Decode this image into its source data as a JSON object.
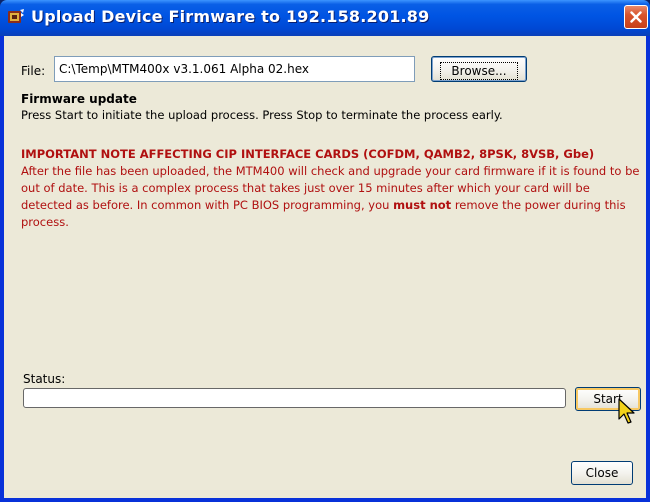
{
  "window": {
    "title": "Upload Device Firmware to 192.158.201.89",
    "icon": "app-icon",
    "close_icon": "close-icon"
  },
  "file": {
    "label": "File:",
    "value": "C:\\Temp\\MTM400x v3.1.061 Alpha 02.hex",
    "browse_label": "Browse..."
  },
  "firmware": {
    "title": "Firmware update",
    "description": "Press Start to initiate the upload process. Press Stop to terminate the process early."
  },
  "important": {
    "title": "IMPORTANT NOTE AFFECTING CIP INTERFACE CARDS (COFDM, QAMB2, 8PSK, 8VSB, Gbe)",
    "body_before": "After the file has been uploaded, the MTM400 will check and upgrade your card firmware if it is found to be out of date. This is a complex process that takes just over 15 minutes after which your card will be detected as before. In common with PC BIOS programming, you ",
    "body_bold": "must not",
    "body_after": " remove the power during this process."
  },
  "status": {
    "label": "Status:",
    "progress": 0
  },
  "buttons": {
    "start": "Start",
    "close": "Close"
  },
  "colors": {
    "titlebar": "#0054e3",
    "dialog_bg": "#ece9d8",
    "warning_text": "#b01010",
    "close_button": "#d9542c"
  }
}
